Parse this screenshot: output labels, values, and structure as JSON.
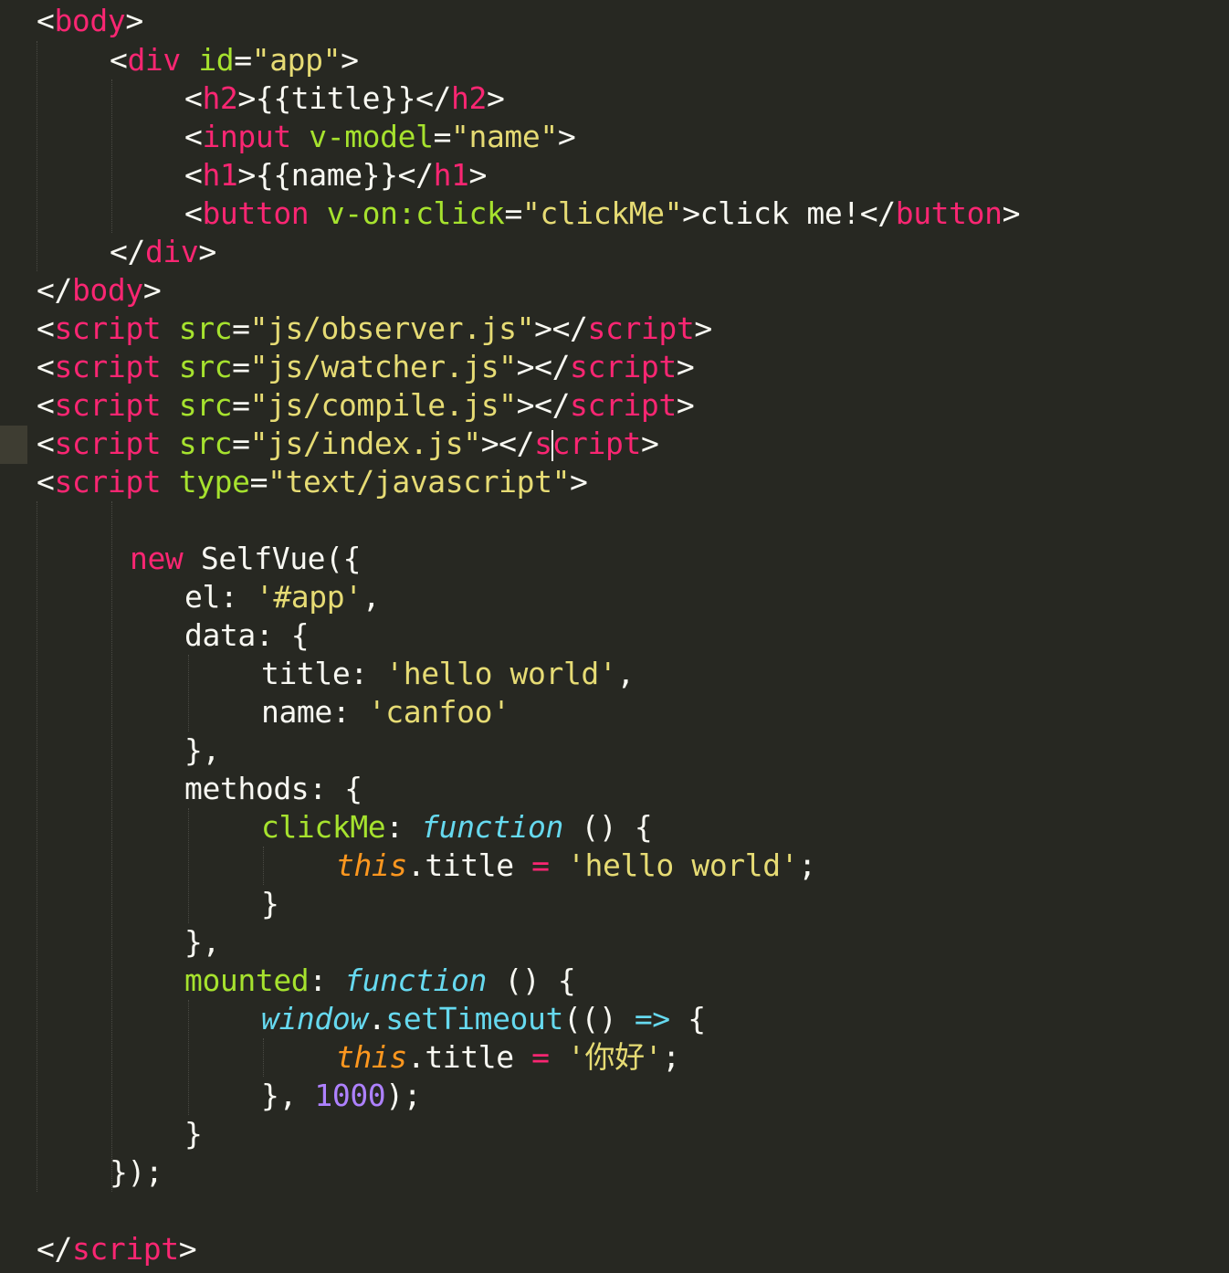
{
  "editor": {
    "theme_colors": {
      "background": "#272822",
      "tag": "#f92672",
      "attribute": "#a6e22e",
      "string": "#e6db74",
      "plain": "#f8f8f2",
      "storage_type": "#66d9ef",
      "this": "#fd971f",
      "number": "#ae81ff"
    },
    "highlighted_line": 12,
    "lines": [
      {
        "tokens": [
          [
            "pl",
            "<"
          ],
          [
            "tag",
            "body"
          ],
          [
            "pl",
            ">"
          ]
        ]
      },
      {
        "tokens": [
          [
            "pl",
            "<"
          ],
          [
            "tag",
            "div"
          ],
          [
            "pl",
            " "
          ],
          [
            "attr",
            "id"
          ],
          [
            "pl",
            "="
          ],
          [
            "str",
            "\"app\""
          ],
          [
            "pl",
            ">"
          ]
        ]
      },
      {
        "tokens": [
          [
            "pl",
            "<"
          ],
          [
            "tag",
            "h2"
          ],
          [
            "pl",
            ">{{title}}</"
          ],
          [
            "tag",
            "h2"
          ],
          [
            "pl",
            ">"
          ]
        ]
      },
      {
        "tokens": [
          [
            "pl",
            "<"
          ],
          [
            "tag",
            "input"
          ],
          [
            "pl",
            " "
          ],
          [
            "attr",
            "v-model"
          ],
          [
            "pl",
            "="
          ],
          [
            "str",
            "\"name\""
          ],
          [
            "pl",
            ">"
          ]
        ]
      },
      {
        "tokens": [
          [
            "pl",
            "<"
          ],
          [
            "tag",
            "h1"
          ],
          [
            "pl",
            ">{{name}}</"
          ],
          [
            "tag",
            "h1"
          ],
          [
            "pl",
            ">"
          ]
        ]
      },
      {
        "tokens": [
          [
            "pl",
            "<"
          ],
          [
            "tag",
            "button"
          ],
          [
            "pl",
            " "
          ],
          [
            "attr",
            "v-on:click"
          ],
          [
            "pl",
            "="
          ],
          [
            "str",
            "\"clickMe\""
          ],
          [
            "pl",
            ">click me!</"
          ],
          [
            "tag",
            "button"
          ],
          [
            "pl",
            ">"
          ]
        ]
      },
      {
        "tokens": [
          [
            "pl",
            "</"
          ],
          [
            "tag",
            "div"
          ],
          [
            "pl",
            ">"
          ]
        ]
      },
      {
        "tokens": [
          [
            "pl",
            "</"
          ],
          [
            "tag",
            "body"
          ],
          [
            "pl",
            ">"
          ]
        ]
      },
      {
        "tokens": [
          [
            "pl",
            "<"
          ],
          [
            "tag",
            "script"
          ],
          [
            "pl",
            " "
          ],
          [
            "attr",
            "src"
          ],
          [
            "pl",
            "="
          ],
          [
            "str",
            "\"js/observer.js\""
          ],
          [
            "pl",
            "></"
          ],
          [
            "tag",
            "script"
          ],
          [
            "pl",
            ">"
          ]
        ]
      },
      {
        "tokens": [
          [
            "pl",
            "<"
          ],
          [
            "tag",
            "script"
          ],
          [
            "pl",
            " "
          ],
          [
            "attr",
            "src"
          ],
          [
            "pl",
            "="
          ],
          [
            "str",
            "\"js/watcher.js\""
          ],
          [
            "pl",
            "></"
          ],
          [
            "tag",
            "script"
          ],
          [
            "pl",
            ">"
          ]
        ]
      },
      {
        "tokens": [
          [
            "pl",
            "<"
          ],
          [
            "tag",
            "script"
          ],
          [
            "pl",
            " "
          ],
          [
            "attr",
            "src"
          ],
          [
            "pl",
            "="
          ],
          [
            "str",
            "\"js/compile.js\""
          ],
          [
            "pl",
            "></"
          ],
          [
            "tag",
            "script"
          ],
          [
            "pl",
            ">"
          ]
        ]
      },
      {
        "tokens": [
          [
            "pl",
            "<"
          ],
          [
            "tag",
            "script"
          ],
          [
            "pl",
            " "
          ],
          [
            "attr",
            "src"
          ],
          [
            "pl",
            "="
          ],
          [
            "str",
            "\"js/index.js\""
          ],
          [
            "pl",
            "></"
          ],
          [
            "tag",
            "s"
          ],
          [
            "cursor",
            ""
          ],
          [
            "tag",
            "cript"
          ],
          [
            "pl",
            ">"
          ]
        ]
      },
      {
        "tokens": [
          [
            "pl",
            "<"
          ],
          [
            "tag",
            "script"
          ],
          [
            "pl",
            " "
          ],
          [
            "attr",
            "type"
          ],
          [
            "pl",
            "="
          ],
          [
            "str",
            "\"text/javascript\""
          ],
          [
            "pl",
            ">"
          ]
        ]
      },
      {
        "tokens": []
      },
      {
        "tokens": [
          [
            "kw",
            "new"
          ],
          [
            "pl",
            " SelfVue({"
          ]
        ]
      },
      {
        "tokens": [
          [
            "pl",
            "el: "
          ],
          [
            "str",
            "'#app'"
          ],
          [
            "pl",
            ","
          ]
        ]
      },
      {
        "tokens": [
          [
            "pl",
            "data: {"
          ]
        ]
      },
      {
        "tokens": [
          [
            "pl",
            "title: "
          ],
          [
            "str",
            "'hello world'"
          ],
          [
            "pl",
            ","
          ]
        ]
      },
      {
        "tokens": [
          [
            "pl",
            "name: "
          ],
          [
            "str",
            "'canfoo'"
          ]
        ]
      },
      {
        "tokens": [
          [
            "pl",
            "},"
          ]
        ]
      },
      {
        "tokens": [
          [
            "pl",
            "methods: {"
          ]
        ]
      },
      {
        "tokens": [
          [
            "prop",
            "clickMe"
          ],
          [
            "pl",
            ": "
          ],
          [
            "fn",
            "function"
          ],
          [
            "pl",
            " () {"
          ]
        ]
      },
      {
        "tokens": [
          [
            "this",
            "this"
          ],
          [
            "pl",
            ".title "
          ],
          [
            "op",
            "="
          ],
          [
            "pl",
            " "
          ],
          [
            "str",
            "'hello world'"
          ],
          [
            "pl",
            ";"
          ]
        ]
      },
      {
        "tokens": [
          [
            "pl",
            "}"
          ]
        ]
      },
      {
        "tokens": [
          [
            "pl",
            "},"
          ]
        ]
      },
      {
        "tokens": [
          [
            "prop",
            "mounted"
          ],
          [
            "pl",
            ": "
          ],
          [
            "fn",
            "function"
          ],
          [
            "pl",
            " () {"
          ]
        ]
      },
      {
        "tokens": [
          [
            "fn",
            "window"
          ],
          [
            "pl",
            "."
          ],
          [
            "sup",
            "setTimeout"
          ],
          [
            "pl",
            "(() "
          ],
          [
            "arrow",
            "=>"
          ],
          [
            "pl",
            " {"
          ]
        ]
      },
      {
        "tokens": [
          [
            "this",
            "this"
          ],
          [
            "pl",
            ".title "
          ],
          [
            "op",
            "="
          ],
          [
            "pl",
            " "
          ],
          [
            "str",
            "'你好'"
          ],
          [
            "pl",
            ";"
          ]
        ]
      },
      {
        "tokens": [
          [
            "pl",
            "}, "
          ],
          [
            "num",
            "1000"
          ],
          [
            "pl",
            ");"
          ]
        ]
      },
      {
        "tokens": [
          [
            "pl",
            "}"
          ]
        ]
      },
      {
        "tokens": [
          [
            "pl",
            "});"
          ]
        ]
      },
      {
        "tokens": []
      },
      {
        "tokens": [
          [
            "pl",
            "</"
          ],
          [
            "tag",
            "script"
          ],
          [
            "pl",
            ">"
          ]
        ]
      }
    ]
  }
}
